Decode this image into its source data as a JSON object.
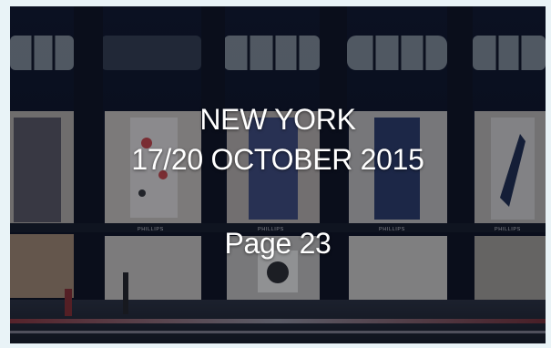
{
  "cover": {
    "city": "NEW YORK",
    "dates": "17/20 OCTOBER 2015",
    "page": "Page 23"
  },
  "photo": {
    "signage": [
      "PHILLIPS",
      "PHILLIPS",
      "PHILLIPS",
      "PHILLIPS",
      "PHILLIPS"
    ]
  },
  "colors": {
    "page_background": "#e9f3f7",
    "text": "#ffffff",
    "facade": "#0d1220",
    "street_light": "#c23a3a"
  }
}
